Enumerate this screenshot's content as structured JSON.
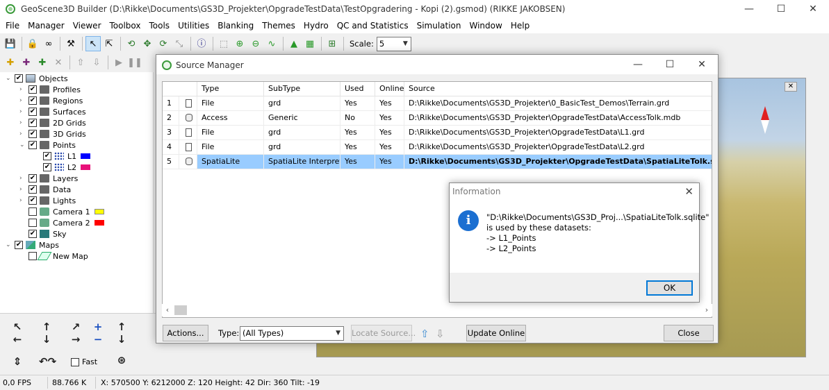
{
  "window": {
    "title": "GeoScene3D Builder (D:\\Rikke\\Documents\\GS3D_Projekter\\OpgradeTestData\\TestOpgradering - Kopi (2).gsmod) (RIKKE JAKOBSEN)",
    "minimize": "—",
    "maximize": "☐",
    "close": "✕"
  },
  "menu": [
    "File",
    "Manager",
    "Viewer",
    "Toolbox",
    "Tools",
    "Utilities",
    "Blanking",
    "Themes",
    "Hydro",
    "QC and Statistics",
    "Simulation",
    "Window",
    "Help"
  ],
  "toolbar": {
    "scale_label": "Scale:",
    "scale_value": "5"
  },
  "tree": {
    "objects": "Objects",
    "profiles": "Profiles",
    "regions": "Regions",
    "surfaces": "Surfaces",
    "grids2d": "2D Grids",
    "grids3d": "3D Grids",
    "points": "Points",
    "l1": "L1",
    "l2": "L2",
    "layers": "Layers",
    "data": "Data",
    "lights": "Lights",
    "camera1": "Camera 1",
    "camera2": "Camera 2",
    "sky": "Sky",
    "maps": "Maps",
    "newmap": "New Map",
    "colors": {
      "l1": "#0000ff",
      "l2": "#e8107a",
      "camera1": "#ffff00",
      "camera2": "#ff0000"
    }
  },
  "nav": {
    "fast_label": "Fast"
  },
  "status": {
    "fps": "0,0 FPS",
    "memory": "88.766 K",
    "coords": "X: 570500  Y: 6212000  Z: 120  Height: 42  Dir: 360  Tilt: -19"
  },
  "source_manager": {
    "title": "Source Manager",
    "columns": [
      "",
      "Type",
      "SubType",
      "Used",
      "Online",
      "Source"
    ],
    "rows": [
      {
        "num": "1",
        "icon": "file-icon",
        "type": "File",
        "subtype": "grd",
        "used": "Yes",
        "online": "Yes",
        "source": "D:\\Rikke\\Documents\\GS3D_Projekter\\0_BasicTest_Demos\\Terrain.grd"
      },
      {
        "num": "2",
        "icon": "database-icon",
        "type": "Access",
        "subtype": "Generic",
        "used": "No",
        "online": "Yes",
        "source": "D:\\Rikke\\Documents\\GS3D_Projekter\\OpgradeTestData\\AccessTolk.mdb"
      },
      {
        "num": "3",
        "icon": "file-icon",
        "type": "File",
        "subtype": "grd",
        "used": "Yes",
        "online": "Yes",
        "source": "D:\\Rikke\\Documents\\GS3D_Projekter\\OpgradeTestData\\L1.grd"
      },
      {
        "num": "4",
        "icon": "file-icon",
        "type": "File",
        "subtype": "grd",
        "used": "Yes",
        "online": "Yes",
        "source": "D:\\Rikke\\Documents\\GS3D_Projekter\\OpgradeTestData\\L2.grd"
      },
      {
        "num": "5",
        "icon": "database-icon",
        "type": "SpatiaLite",
        "subtype": "SpatiaLite Interpretat",
        "used": "Yes",
        "online": "Yes",
        "source": "D:\\Rikke\\Documents\\GS3D_Projekter\\OpgradeTestData\\SpatiaLiteTolk.sqlite"
      }
    ],
    "actions_button": "Actions...",
    "type_label": "Type:",
    "type_value": "(All Types)",
    "locate_button": "Locate Source...",
    "update_button": "Update Online",
    "close_button": "Close"
  },
  "info_dialog": {
    "title": "Information",
    "line1": "\"D:\\Rikke\\Documents\\GS3D_Proj...\\SpatiaLiteTolk.sqlite\"",
    "line2": "is used by these datasets:",
    "line3": "-> L1_Points",
    "line4": "-> L2_Points",
    "ok_button": "OK"
  }
}
